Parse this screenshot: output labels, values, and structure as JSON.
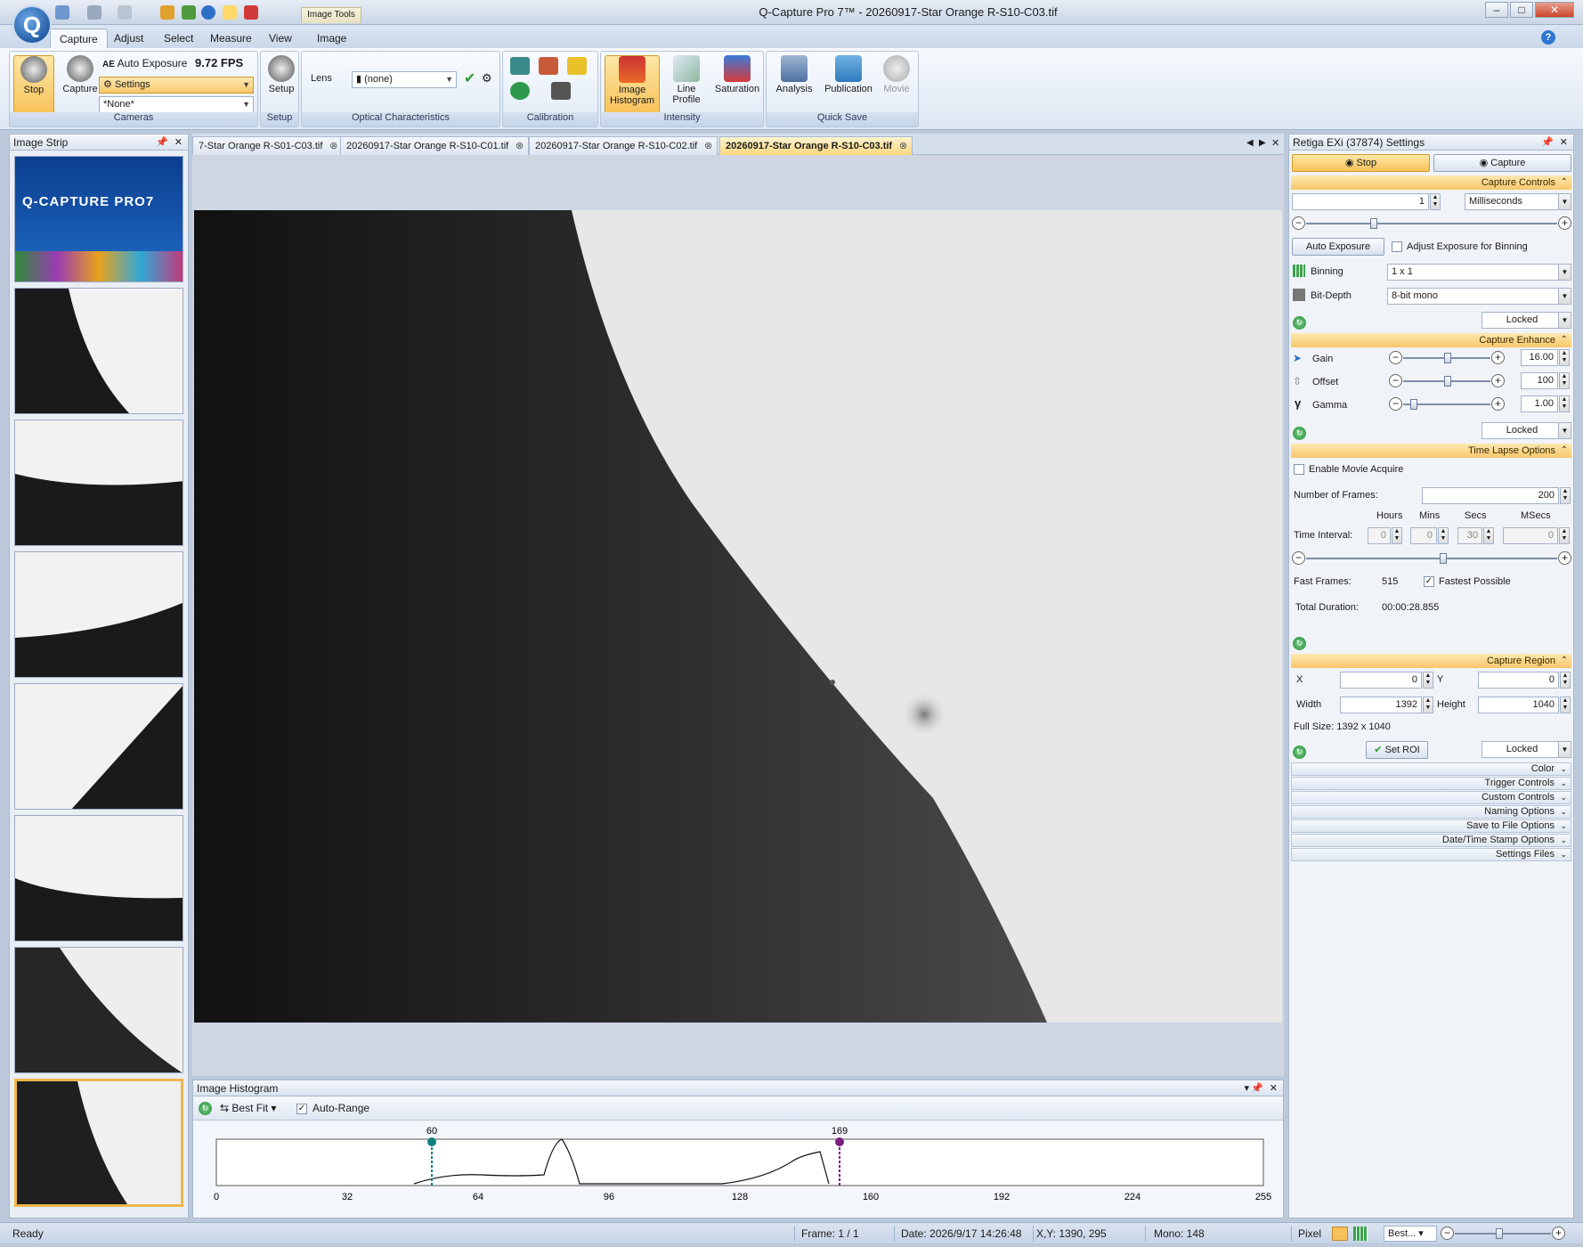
{
  "window": {
    "title": "Q-Capture Pro 7™ - 20260917-Star Orange R-S10-C03.tif",
    "context_tab": "Image Tools"
  },
  "ribbon_tabs": [
    "Capture",
    "Adjust",
    "Select",
    "Measure",
    "View",
    "Image"
  ],
  "ribbon": {
    "stop": "Stop",
    "capture": "Capture",
    "auto_exposure": "Auto Exposure",
    "fps": "9.72 FPS",
    "settings": "Settings",
    "preset": "*None*",
    "cameras": "Cameras",
    "setup": "Setup",
    "setup_group": "Setup",
    "lens_label": "Lens",
    "lens_value": "(none)",
    "optical": "Optical Characteristics",
    "calibration": "Calibration",
    "image_histogram": "Image Histogram",
    "line_profile": "Line Profile",
    "saturation": "Saturation",
    "intensity": "Intensity",
    "analysis": "Analysis",
    "publication": "Publication",
    "movie": "Movie",
    "quick_save": "Quick Save"
  },
  "image_strip": {
    "title": "Image Strip",
    "splash_text": "Q-CAPTURE PRO7"
  },
  "doc_tabs": [
    "7-Star Orange R-S01-C03.tif",
    "20260917-Star Orange R-S10-C01.tif",
    "20260917-Star Orange R-S10-C02.tif",
    "20260917-Star Orange R-S10-C03.tif"
  ],
  "histogram": {
    "title": "Image Histogram",
    "fit": "Best Fit",
    "auto_range": "Auto-Range",
    "markers": [
      "60",
      "169"
    ],
    "ticks": [
      "0",
      "32",
      "64",
      "96",
      "128",
      "160",
      "192",
      "224",
      "255"
    ]
  },
  "settings": {
    "title": "Retiga EXi (37874) Settings",
    "stop": "Stop",
    "capture": "Capture",
    "capture_controls": "Capture Controls",
    "exposure_value": "1",
    "exposure_unit": "Milliseconds",
    "auto_exposure": "Auto Exposure",
    "adjust_binning": "Adjust Exposure for Binning",
    "binning_label": "Binning",
    "binning_value": "1 x 1",
    "bitdepth_label": "Bit-Depth",
    "bitdepth_value": "8-bit mono",
    "locked": "Locked",
    "capture_enhance": "Capture Enhance",
    "gain_label": "Gain",
    "gain_value": "16.00",
    "offset_label": "Offset",
    "offset_value": "100",
    "gamma_label": "Gamma",
    "gamma_value": "1.00",
    "time_lapse": "Time Lapse Options",
    "enable_movie": "Enable Movie Acquire",
    "frames_label": "Number of  Frames:",
    "frames_value": "200",
    "hours": "Hours",
    "mins": "Mins",
    "secs": "Secs",
    "msecs": "MSecs",
    "interval_label": "Time Interval:",
    "interval": [
      "0",
      "0",
      "30",
      "0"
    ],
    "fast_frames_label": "Fast Frames:",
    "fast_frames_value": "515",
    "fastest": "Fastest Possible",
    "total_duration_label": "Total Duration:",
    "total_duration_value": "00:00:28.855",
    "capture_region": "Capture Region",
    "x_label": "X",
    "x_value": "0",
    "y_label": "Y",
    "y_value": "0",
    "width_label": "Width",
    "width_value": "1392",
    "height_label": "Height",
    "height_value": "1040",
    "full_size": "Full Size: 1392 x 1040",
    "set_roi": "Set ROI",
    "collapsed": [
      "Color",
      "Trigger Controls",
      "Custom Controls",
      "Naming Options",
      "Save to File Options",
      "Date/Time Stamp Options",
      "Settings Files"
    ]
  },
  "status": {
    "ready": "Ready",
    "frame": "Frame: 1 / 1",
    "date": "Date: 2026/9/17 14:26:48",
    "xy": "X,Y: 1390,  295",
    "mono": "Mono:  148",
    "pixel": "Pixel",
    "zoom": "Best..."
  },
  "colors": {
    "accent": "#f8c76a",
    "ribbon": "#dde7f3",
    "marker_low": "#0f8080",
    "marker_high": "#7a1f7a"
  }
}
